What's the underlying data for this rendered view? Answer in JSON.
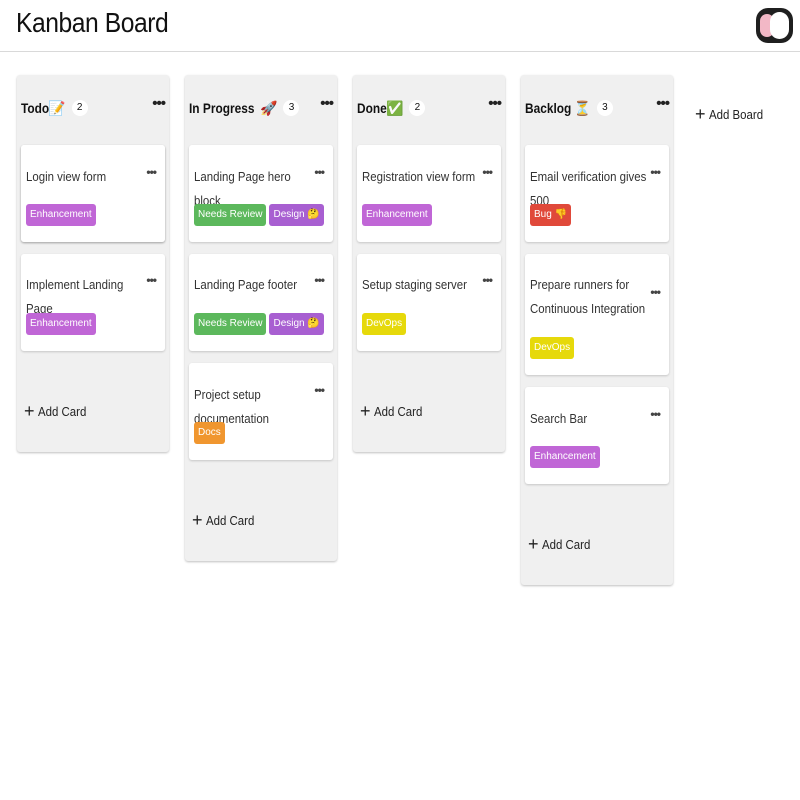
{
  "app": {
    "title": "Kanban Board",
    "theme_toggle_icon": "theme-toggle-icon"
  },
  "tag_colors": {
    "Enhancement": "#c066d6",
    "Needs Review": "#5cb85c",
    "Design": "#a85fd1",
    "Docs": "#f0962f",
    "DevOps": "#e6d90b",
    "Bug": "#e0493a"
  },
  "boards": [
    {
      "title": "Todo",
      "emoji": "📝",
      "count": "2",
      "menu": "•••",
      "cards": [
        {
          "title": "Login view form",
          "menu": "•••",
          "tags": [
            {
              "label": "Enhancement",
              "color": "#c066d6"
            }
          ]
        },
        {
          "title": "Implement Landing Page",
          "menu": "•••",
          "tags": [
            {
              "label": "Enhancement",
              "color": "#c066d6"
            }
          ]
        }
      ],
      "add_card_label": "Add Card"
    },
    {
      "title": "In Progress",
      "emoji": "🚀",
      "count": "3",
      "menu": "•••",
      "cards": [
        {
          "title": "Landing Page hero block",
          "menu": "•••",
          "tags": [
            {
              "label": "Needs Review",
              "color": "#5cb85c"
            },
            {
              "label": "Design 🤔",
              "color": "#a85fd1"
            }
          ]
        },
        {
          "title": "Landing Page footer",
          "menu": "•••",
          "tags": [
            {
              "label": "Needs Review",
              "color": "#5cb85c"
            },
            {
              "label": "Design 🤔",
              "color": "#a85fd1"
            }
          ]
        },
        {
          "title": "Project setup documentation",
          "menu": "•••",
          "tags": [
            {
              "label": "Docs",
              "color": "#f0962f"
            }
          ]
        }
      ],
      "add_card_label": "Add Card"
    },
    {
      "title": "Done",
      "emoji": "✅",
      "count": "2",
      "menu": "•••",
      "cards": [
        {
          "title": "Registration view form",
          "menu": "•••",
          "tags": [
            {
              "label": "Enhancement",
              "color": "#c066d6"
            }
          ]
        },
        {
          "title": "Setup staging server",
          "menu": "•••",
          "tags": [
            {
              "label": "DevOps",
              "color": "#e6d90b"
            }
          ]
        }
      ],
      "add_card_label": "Add Card"
    },
    {
      "title": "Backlog",
      "emoji": "⏳",
      "count": "3",
      "menu": "•••",
      "cards": [
        {
          "title": "Email verification gives 500",
          "menu": "•••",
          "tags": [
            {
              "label": "Bug 👎",
              "color": "#e0493a"
            }
          ]
        },
        {
          "title": "Prepare runners for Continuous Integration",
          "menu": "•••",
          "tags": [
            {
              "label": "DevOps",
              "color": "#e6d90b"
            }
          ]
        },
        {
          "title": "Search Bar",
          "menu": "•••",
          "tags": [
            {
              "label": "Enhancement",
              "color": "#c066d6"
            }
          ]
        }
      ],
      "add_card_label": "Add Card"
    }
  ],
  "add_board_label": "Add Board"
}
